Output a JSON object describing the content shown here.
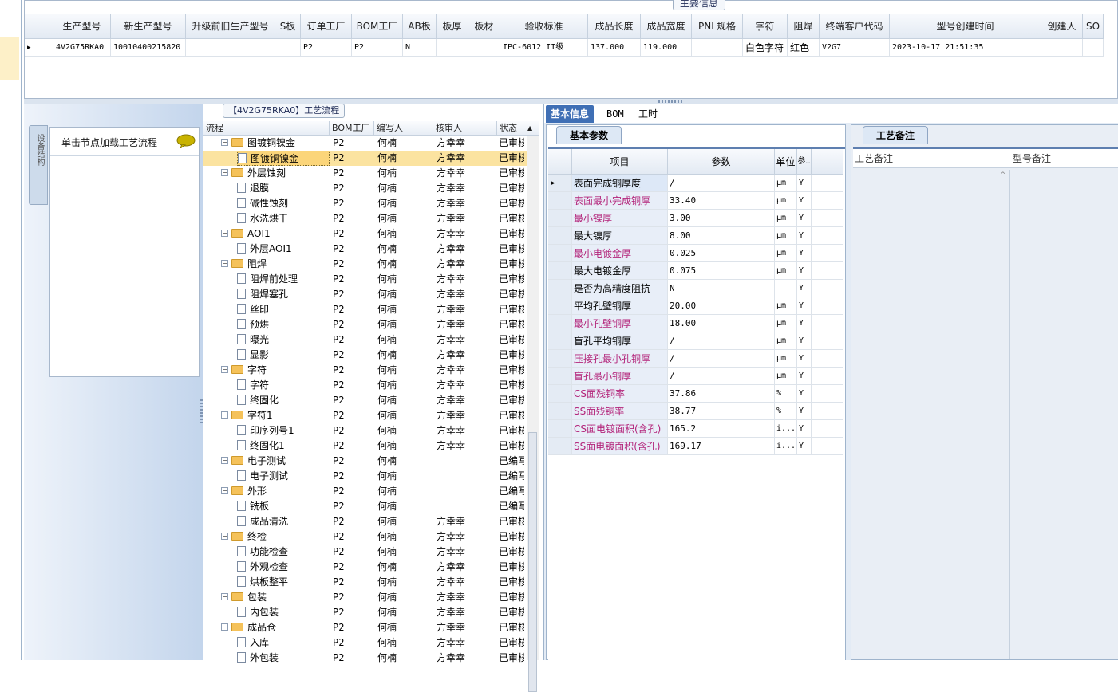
{
  "top": {
    "caption": "主要信息",
    "headers": [
      "生产型号",
      "新生产型号",
      "升级前旧生产型号",
      "S板",
      "订单工厂",
      "BOM工厂",
      "AB板",
      "板厚",
      "板材",
      "验收标准",
      "成品长度",
      "成品宽度",
      "PNL规格",
      "字符",
      "阻焊",
      "终端客户代码",
      "型号创建时间",
      "创建人",
      "SO"
    ],
    "row": [
      "4V2G75RKA0",
      "10010400215820",
      "",
      "",
      "P2",
      "P2",
      "N",
      "",
      "",
      "IPC-6012 II级",
      "137.000",
      "119.000",
      "",
      "白色字符",
      "红色",
      "V2G7",
      "2023-10-17 21:51:35",
      "",
      ""
    ]
  },
  "tip": {
    "text": "单击节点加载工艺流程",
    "vertical_tab": "设备结构"
  },
  "tree": {
    "caption": "【4V2G75RKA0】工艺流程",
    "headers": [
      "流程",
      "BOM工厂",
      "编写人",
      "核审人",
      "状态"
    ],
    "rows": [
      {
        "name": "图镀铜镍金",
        "level": 0,
        "factory": "P2",
        "writer": "何楠",
        "checker": "方幸幸",
        "status": "已审核"
      },
      {
        "name": "图镀铜镍金",
        "level": 1,
        "factory": "P2",
        "writer": "何楠",
        "checker": "方幸幸",
        "status": "已审核",
        "selected": true
      },
      {
        "name": "外层蚀刻",
        "level": 0,
        "factory": "P2",
        "writer": "何楠",
        "checker": "方幸幸",
        "status": "已审核"
      },
      {
        "name": "退膜",
        "level": 1,
        "factory": "P2",
        "writer": "何楠",
        "checker": "方幸幸",
        "status": "已审核"
      },
      {
        "name": "碱性蚀刻",
        "level": 1,
        "factory": "P2",
        "writer": "何楠",
        "checker": "方幸幸",
        "status": "已审核"
      },
      {
        "name": "水洗烘干",
        "level": 1,
        "factory": "P2",
        "writer": "何楠",
        "checker": "方幸幸",
        "status": "已审核"
      },
      {
        "name": "AOI1",
        "level": 0,
        "factory": "P2",
        "writer": "何楠",
        "checker": "方幸幸",
        "status": "已审核"
      },
      {
        "name": "外层AOI1",
        "level": 1,
        "factory": "P2",
        "writer": "何楠",
        "checker": "方幸幸",
        "status": "已审核"
      },
      {
        "name": "阻焊",
        "level": 0,
        "factory": "P2",
        "writer": "何楠",
        "checker": "方幸幸",
        "status": "已审核"
      },
      {
        "name": "阻焊前处理",
        "level": 1,
        "factory": "P2",
        "writer": "何楠",
        "checker": "方幸幸",
        "status": "已审核"
      },
      {
        "name": "阻焊塞孔",
        "level": 1,
        "factory": "P2",
        "writer": "何楠",
        "checker": "方幸幸",
        "status": "已审核"
      },
      {
        "name": "丝印",
        "level": 1,
        "factory": "P2",
        "writer": "何楠",
        "checker": "方幸幸",
        "status": "已审核"
      },
      {
        "name": "预烘",
        "level": 1,
        "factory": "P2",
        "writer": "何楠",
        "checker": "方幸幸",
        "status": "已审核"
      },
      {
        "name": "曝光",
        "level": 1,
        "factory": "P2",
        "writer": "何楠",
        "checker": "方幸幸",
        "status": "已审核"
      },
      {
        "name": "显影",
        "level": 1,
        "factory": "P2",
        "writer": "何楠",
        "checker": "方幸幸",
        "status": "已审核"
      },
      {
        "name": "字符",
        "level": 0,
        "factory": "P2",
        "writer": "何楠",
        "checker": "方幸幸",
        "status": "已审核"
      },
      {
        "name": "字符",
        "level": 1,
        "factory": "P2",
        "writer": "何楠",
        "checker": "方幸幸",
        "status": "已审核"
      },
      {
        "name": "终固化",
        "level": 1,
        "factory": "P2",
        "writer": "何楠",
        "checker": "方幸幸",
        "status": "已审核"
      },
      {
        "name": "字符1",
        "level": 0,
        "factory": "P2",
        "writer": "何楠",
        "checker": "方幸幸",
        "status": "已审核"
      },
      {
        "name": "印序列号1",
        "level": 1,
        "factory": "P2",
        "writer": "何楠",
        "checker": "方幸幸",
        "status": "已审核"
      },
      {
        "name": "终固化1",
        "level": 1,
        "factory": "P2",
        "writer": "何楠",
        "checker": "方幸幸",
        "status": "已审核"
      },
      {
        "name": "电子测试",
        "level": 0,
        "factory": "P2",
        "writer": "何楠",
        "checker": "",
        "status": "已编写"
      },
      {
        "name": "电子测试",
        "level": 1,
        "factory": "P2",
        "writer": "何楠",
        "checker": "",
        "status": "已编写"
      },
      {
        "name": "外形",
        "level": 0,
        "factory": "P2",
        "writer": "何楠",
        "checker": "",
        "status": "已编写"
      },
      {
        "name": "铣板",
        "level": 1,
        "factory": "P2",
        "writer": "何楠",
        "checker": "",
        "status": "已编写"
      },
      {
        "name": "成品清洗",
        "level": 1,
        "factory": "P2",
        "writer": "何楠",
        "checker": "方幸幸",
        "status": "已审核"
      },
      {
        "name": "终检",
        "level": 0,
        "factory": "P2",
        "writer": "何楠",
        "checker": "方幸幸",
        "status": "已审核"
      },
      {
        "name": "功能检查",
        "level": 1,
        "factory": "P2",
        "writer": "何楠",
        "checker": "方幸幸",
        "status": "已审核"
      },
      {
        "name": "外观检查",
        "level": 1,
        "factory": "P2",
        "writer": "何楠",
        "checker": "方幸幸",
        "status": "已审核"
      },
      {
        "name": "烘板整平",
        "level": 1,
        "factory": "P2",
        "writer": "何楠",
        "checker": "方幸幸",
        "status": "已审核"
      },
      {
        "name": "包装",
        "level": 0,
        "factory": "P2",
        "writer": "何楠",
        "checker": "方幸幸",
        "status": "已审核"
      },
      {
        "name": "内包装",
        "level": 1,
        "factory": "P2",
        "writer": "何楠",
        "checker": "方幸幸",
        "status": "已审核"
      },
      {
        "name": "成品仓",
        "level": 0,
        "factory": "P2",
        "writer": "何楠",
        "checker": "方幸幸",
        "status": "已审核"
      },
      {
        "name": "入库",
        "level": 1,
        "factory": "P2",
        "writer": "何楠",
        "checker": "方幸幸",
        "status": "已审核"
      },
      {
        "name": "外包装",
        "level": 1,
        "factory": "P2",
        "writer": "何楠",
        "checker": "方幸幸",
        "status": "已审核"
      }
    ]
  },
  "right_tabs": [
    "基本信息",
    "BOM",
    "工时"
  ],
  "basic": {
    "tab": "基本参数",
    "headers": [
      "项目",
      "参数",
      "单位",
      "参.."
    ],
    "rows": [
      {
        "name": "表面完成铜厚度",
        "value": "/",
        "unit": "μm",
        "flag": "Y",
        "pink": false
      },
      {
        "name": "表面最小完成铜厚",
        "value": "33.40",
        "unit": "μm",
        "flag": "Y",
        "pink": true
      },
      {
        "name": "最小镍厚",
        "value": "3.00",
        "unit": "μm",
        "flag": "Y",
        "pink": true
      },
      {
        "name": "最大镍厚",
        "value": "8.00",
        "unit": "μm",
        "flag": "Y",
        "pink": false
      },
      {
        "name": "最小电镀金厚",
        "value": "0.025",
        "unit": "μm",
        "flag": "Y",
        "pink": true
      },
      {
        "name": "最大电镀金厚",
        "value": "0.075",
        "unit": "μm",
        "flag": "Y",
        "pink": false
      },
      {
        "name": "是否为高精度阻抗",
        "value": "N",
        "unit": "",
        "flag": "Y",
        "pink": false
      },
      {
        "name": "平均孔壁铜厚",
        "value": "20.00",
        "unit": "μm",
        "flag": "Y",
        "pink": false
      },
      {
        "name": "最小孔壁铜厚",
        "value": "18.00",
        "unit": "μm",
        "flag": "Y",
        "pink": true
      },
      {
        "name": "盲孔平均铜厚",
        "value": "/",
        "unit": "μm",
        "flag": "Y",
        "pink": false
      },
      {
        "name": "压接孔最小孔铜厚",
        "value": "/",
        "unit": "μm",
        "flag": "Y",
        "pink": true
      },
      {
        "name": "盲孔最小铜厚",
        "value": "/",
        "unit": "μm",
        "flag": "Y",
        "pink": true
      },
      {
        "name": "CS面残铜率",
        "value": "37.86",
        "unit": "%",
        "flag": "Y",
        "pink": true
      },
      {
        "name": "SS面残铜率",
        "value": "38.77",
        "unit": "%",
        "flag": "Y",
        "pink": true
      },
      {
        "name": "CS面电镀面积(含孔)",
        "value": "165.2",
        "unit": "i...",
        "flag": "Y",
        "pink": true
      },
      {
        "name": "SS面电镀面积(含孔)",
        "value": "169.17",
        "unit": "i...",
        "flag": "Y",
        "pink": true
      }
    ]
  },
  "notes": {
    "tab": "工艺备注",
    "col1": "工艺备注",
    "col2": "型号备注"
  }
}
